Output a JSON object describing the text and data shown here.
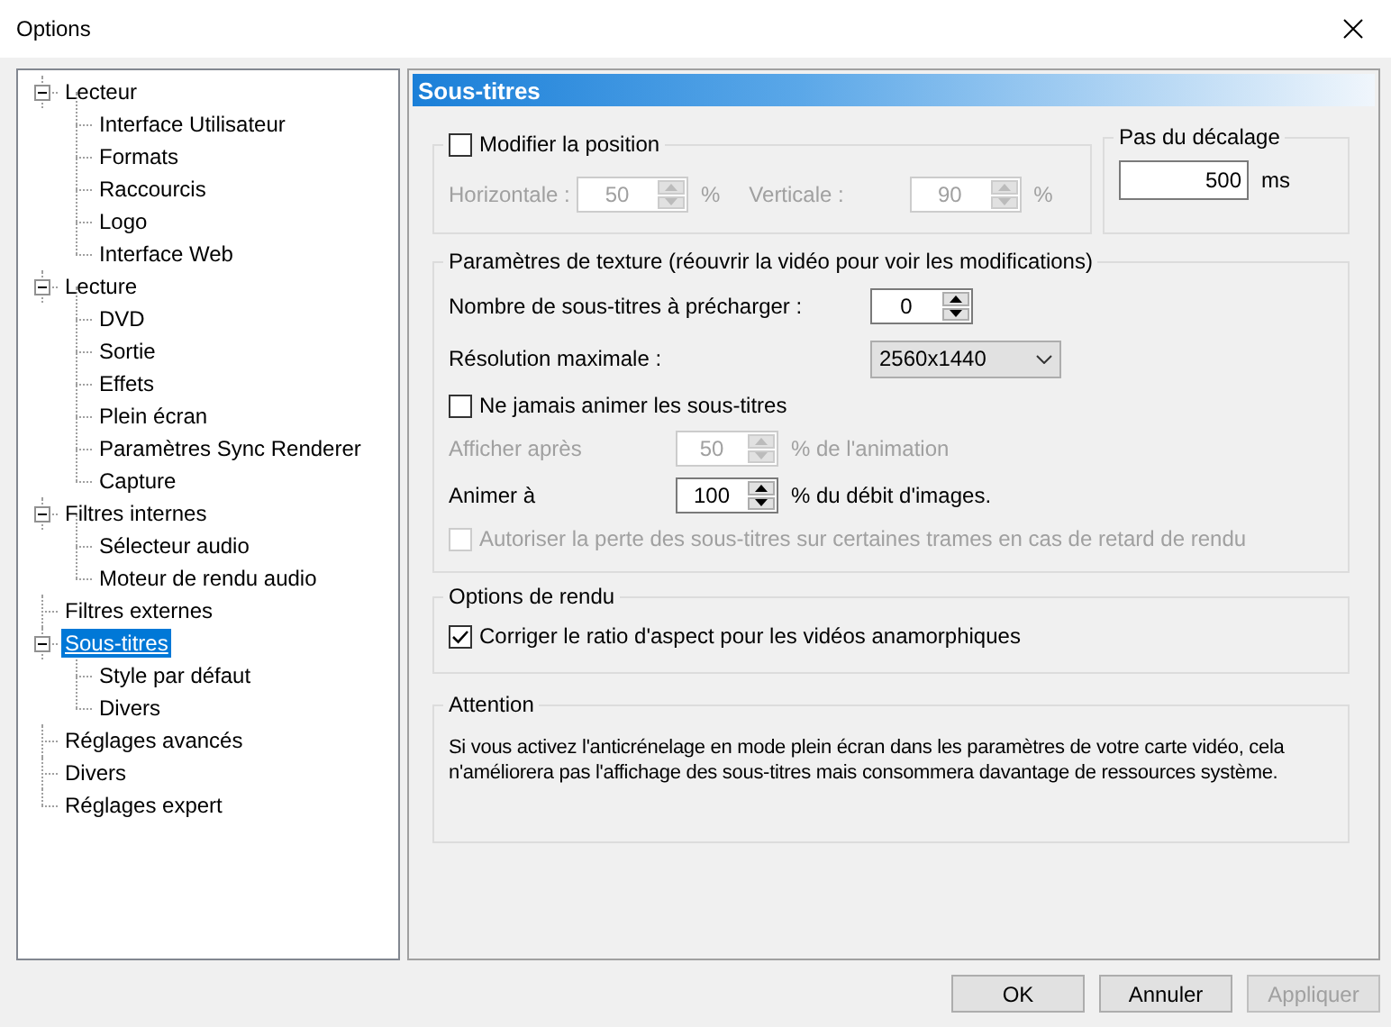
{
  "window": {
    "title": "Options"
  },
  "tree": [
    {
      "label": "Lecteur",
      "expanded": true,
      "selected": false,
      "children": [
        {
          "label": "Interface Utilisateur",
          "selected": false
        },
        {
          "label": "Formats",
          "selected": false
        },
        {
          "label": "Raccourcis",
          "selected": false
        },
        {
          "label": "Logo",
          "selected": false
        },
        {
          "label": "Interface Web",
          "selected": false
        }
      ]
    },
    {
      "label": "Lecture",
      "expanded": true,
      "selected": false,
      "children": [
        {
          "label": "DVD",
          "selected": false
        },
        {
          "label": "Sortie",
          "selected": false
        },
        {
          "label": "Effets",
          "selected": false
        },
        {
          "label": "Plein écran",
          "selected": false
        },
        {
          "label": "Paramètres Sync Renderer",
          "selected": false
        },
        {
          "label": "Capture",
          "selected": false
        }
      ]
    },
    {
      "label": "Filtres internes",
      "expanded": true,
      "selected": false,
      "children": [
        {
          "label": "Sélecteur audio",
          "selected": false
        },
        {
          "label": "Moteur de rendu audio",
          "selected": false
        }
      ]
    },
    {
      "label": "Filtres externes",
      "selected": false
    },
    {
      "label": "Sous-titres",
      "expanded": true,
      "selected": true,
      "children": [
        {
          "label": "Style par défaut",
          "selected": false
        },
        {
          "label": "Divers",
          "selected": false
        }
      ]
    },
    {
      "label": "Réglages avancés",
      "selected": false
    },
    {
      "label": "Divers",
      "selected": false
    },
    {
      "label": "Réglages expert",
      "selected": false
    }
  ],
  "panel": {
    "title": "Sous-titres",
    "position": {
      "label": "Modifier la position",
      "checked": false,
      "fields": [
        {
          "label": "Horizontale :",
          "value": "50",
          "unit": "%",
          "disabled": true
        },
        {
          "label": "Verticale :",
          "value": "90",
          "unit": "%",
          "disabled": true
        }
      ]
    },
    "offset": {
      "title": "Pas du décalage",
      "value": "500",
      "unit": "ms"
    },
    "texture": {
      "title": "Paramètres de texture (réouvrir la vidéo pour voir les modifications)",
      "preload": {
        "label": "Nombre de sous-titres à précharger :",
        "value": "0",
        "disabled": false
      },
      "resolution": {
        "label": "Résolution maximale :",
        "value": "2560x1440"
      },
      "never_animate": {
        "label": "Ne jamais animer les sous-titres",
        "checked": false,
        "disabled": false
      },
      "show_after": {
        "label": "Afficher après",
        "value": "50",
        "unit": "% de l'animation",
        "disabled": true
      },
      "animate_at": {
        "label": "Animer à",
        "value": "100",
        "unit": "% du débit d'images.",
        "disabled": false
      },
      "allow_drop": {
        "label": "Autoriser la perte des sous-titres sur certaines trames en cas de retard de rendu",
        "checked": false,
        "disabled": true
      }
    },
    "rendering": {
      "title": "Options de rendu",
      "aspect": {
        "label": "Corriger le ratio d'aspect pour les vidéos anamorphiques",
        "checked": true,
        "disabled": false
      }
    },
    "attention": {
      "title": "Attention",
      "text": "Si vous activez l'anticrénelage en mode plein écran dans les paramètres de votre carte vidéo, cela n'améliorera pas l'affichage des sous-titres mais consommera davantage de ressources système."
    }
  },
  "buttons": [
    {
      "label": "OK",
      "disabled": false
    },
    {
      "label": "Annuler",
      "disabled": false
    },
    {
      "label": "Appliquer",
      "disabled": true
    }
  ]
}
